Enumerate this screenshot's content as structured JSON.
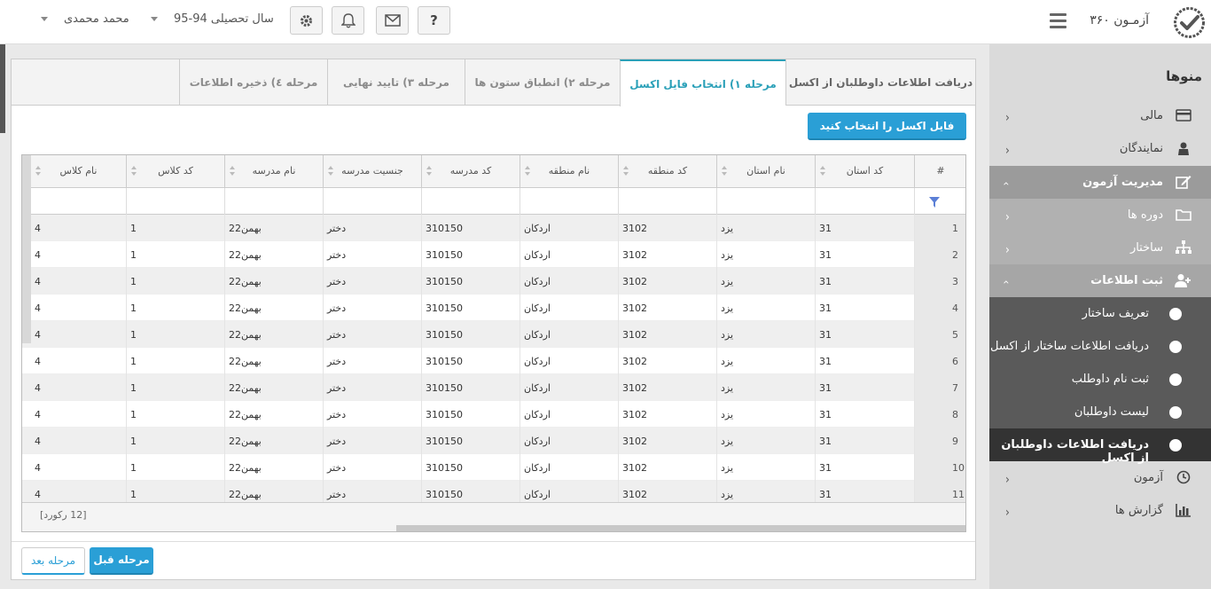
{
  "header": {
    "brand": "آزمـون ۳۶۰",
    "help_label": "?",
    "year_label": "سال تحصیلی 94-95",
    "user_name": "محمد محمدی"
  },
  "sidebar": {
    "title": "منوها",
    "items": [
      {
        "label": "مالی",
        "icon": "card-icon"
      },
      {
        "label": "نمایندگان",
        "icon": "agents-icon"
      },
      {
        "label": "مدیریت آزمون",
        "icon": "edit-icon"
      },
      {
        "label": "دوره ها",
        "icon": "folder-icon"
      },
      {
        "label": "ساختار",
        "icon": "sitemap-icon"
      },
      {
        "label": "ثبت اطلاعات",
        "icon": "user-add-icon"
      },
      {
        "label": "تعریف ساختار"
      },
      {
        "label": "دریافت اطلاعات ساختار از اکسل"
      },
      {
        "label": "ثبت نام داوطلب"
      },
      {
        "label": "لیست داوطلبان"
      },
      {
        "label": "دریافت اطلاعات داوطلبان از اکسل"
      },
      {
        "label": "آزمون",
        "icon": "clock-icon"
      },
      {
        "label": "گزارش ها",
        "icon": "chart-icon"
      }
    ]
  },
  "tabs": [
    {
      "label": "دریافت اطلاعات داوطلبان از اکسل"
    },
    {
      "label": "مرحله ۱) انتخاب فایل اکسل"
    },
    {
      "label": "مرحله ۲) انطباق ستون ها"
    },
    {
      "label": "مرحله ۳) تایید نهایی"
    },
    {
      "label": "مرحله ٤) ذخیره اطلاعات"
    }
  ],
  "file_button": "فایل اکسل را انتخاب کنید",
  "grid": {
    "columns": [
      "#",
      "کد استان",
      "نام استان",
      "کد منطقه",
      "نام منطقه",
      "کد مدرسه",
      "جنسیت مدرسه",
      "نام مدرسه",
      "کد کلاس",
      "نام کلاس"
    ],
    "rows": [
      [
        "1",
        "31",
        "یزد",
        "3102",
        "اردکان",
        "310150",
        "دختر",
        "22بهمن",
        "1",
        "4"
      ],
      [
        "2",
        "31",
        "یزد",
        "3102",
        "اردکان",
        "310150",
        "دختر",
        "22بهمن",
        "1",
        "4"
      ],
      [
        "3",
        "31",
        "یزد",
        "3102",
        "اردکان",
        "310150",
        "دختر",
        "22بهمن",
        "1",
        "4"
      ],
      [
        "4",
        "31",
        "یزد",
        "3102",
        "اردکان",
        "310150",
        "دختر",
        "22بهمن",
        "1",
        "4"
      ],
      [
        "5",
        "31",
        "یزد",
        "3102",
        "اردکان",
        "310150",
        "دختر",
        "22بهمن",
        "1",
        "4"
      ],
      [
        "6",
        "31",
        "یزد",
        "3102",
        "اردکان",
        "310150",
        "دختر",
        "22بهمن",
        "1",
        "4"
      ],
      [
        "7",
        "31",
        "یزد",
        "3102",
        "اردکان",
        "310150",
        "دختر",
        "22بهمن",
        "1",
        "4"
      ],
      [
        "8",
        "31",
        "یزد",
        "3102",
        "اردکان",
        "310150",
        "دختر",
        "22بهمن",
        "1",
        "4"
      ],
      [
        "9",
        "31",
        "یزد",
        "3102",
        "اردکان",
        "310150",
        "دختر",
        "22بهمن",
        "1",
        "4"
      ],
      [
        "10",
        "31",
        "یزد",
        "3102",
        "اردکان",
        "310150",
        "دختر",
        "22بهمن",
        "1",
        "4"
      ],
      [
        "11",
        "31",
        "یزد",
        "3102",
        "اردکان",
        "310150",
        "دختر",
        "22بهمن",
        "1",
        "4"
      ]
    ],
    "record_count": "[12 رکورد]"
  },
  "buttons": {
    "prev": "مرحله قبل",
    "next": "مرحله بعد"
  },
  "colors": {
    "accent": "#2a9fd6",
    "tab_active": "#2aa0b8"
  }
}
